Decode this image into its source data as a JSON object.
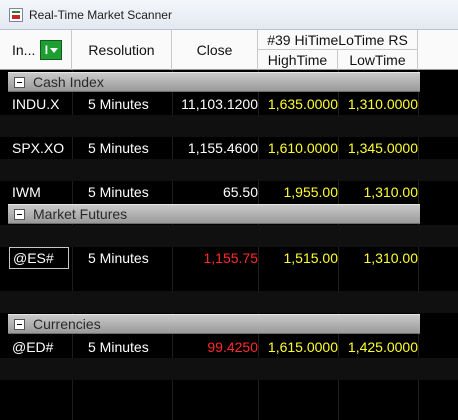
{
  "window": {
    "title": "Real-Time Market Scanner",
    "icon": "scanner-app-icon"
  },
  "header": {
    "instrument": "In...",
    "filter_button": "I",
    "resolution": "Resolution",
    "close": "Close",
    "group_title": "#39 HiTimeLoTime RS",
    "high_time": "HighTime",
    "low_time": "LowTime"
  },
  "colors": {
    "up": "#ffff2e",
    "down": "#ff2a2a",
    "neutral": "#ffffff",
    "filter_button": "#1f9e32"
  },
  "sections": [
    {
      "title": "Cash Index",
      "rows": [
        {
          "symbol": "INDU.X",
          "resolution": "5 Minutes",
          "close": "11,103.1200",
          "close_color": "white",
          "high": "1,635.0000",
          "low": "1,310.0000"
        },
        {
          "symbol": "SPX.XO",
          "resolution": "5 Minutes",
          "close": "1,155.4600",
          "close_color": "white",
          "high": "1,610.0000",
          "low": "1,345.0000"
        },
        {
          "symbol": "IWM",
          "resolution": "5 Minutes",
          "close": "65.50",
          "close_color": "white",
          "high": "1,955.00",
          "low": "1,310.00"
        }
      ]
    },
    {
      "title": "Market Futures",
      "rows": [
        {
          "symbol": "@ES#",
          "resolution": "5 Minutes",
          "close": "1,155.75",
          "close_color": "red",
          "high": "1,515.00",
          "low": "1,310.00"
        }
      ]
    },
    {
      "title": "Currencies",
      "rows": [
        {
          "symbol": "@ED#",
          "resolution": "5 Minutes",
          "close": "99.4250",
          "close_color": "red",
          "high": "1,615.0000",
          "low": "1,425.0000"
        }
      ]
    }
  ]
}
